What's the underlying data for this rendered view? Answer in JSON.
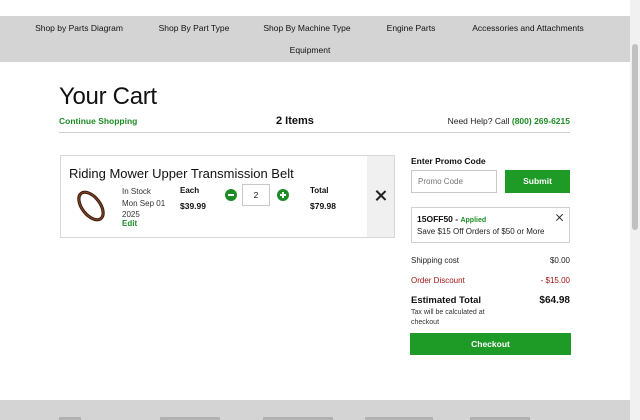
{
  "nav": {
    "items": [
      "Shop by Parts Diagram",
      "Shop By Part Type",
      "Shop By Machine Type",
      "Engine Parts",
      "Accessories and Attachments",
      "Equipment"
    ]
  },
  "header": {
    "title": "Your Cart",
    "continue_label": "Continue Shopping",
    "item_count": "2 Items",
    "help_text": "Need Help? Call",
    "help_phone": "(800) 269-6215"
  },
  "cart": {
    "item": {
      "name": "Riding Mower Upper Transmission Belt",
      "image_icon": "belt-image",
      "stock_status": "In Stock",
      "ship_date": "Mon Sep 01",
      "ship_year": "2025",
      "edit_label": "Edit",
      "each_label": "Each",
      "each_price": "$39.99",
      "quantity": "2",
      "total_label": "Total",
      "total_price": "$79.98",
      "remove_icon": "close-icon"
    }
  },
  "promo": {
    "label": "Enter Promo Code",
    "placeholder": "Promo Code",
    "submit_label": "Submit",
    "applied_code": "15OFF50",
    "applied_separator": " - ",
    "applied_status": "Applied",
    "applied_description": "Save $15 Off Orders of $50 or More"
  },
  "summary": {
    "shipping_label": "Shipping cost",
    "shipping_value": "$0.00",
    "discount_label": "Order Discount",
    "discount_value": "- $15.00",
    "total_label": "Estimated Total",
    "total_value": "$64.98",
    "tax_note": "Tax will be calculated at checkout",
    "checkout_label": "Checkout"
  },
  "colors": {
    "accent_green": "#1e9a26",
    "discount_red": "#a31515",
    "nav_gray": "#d4d4d4"
  }
}
